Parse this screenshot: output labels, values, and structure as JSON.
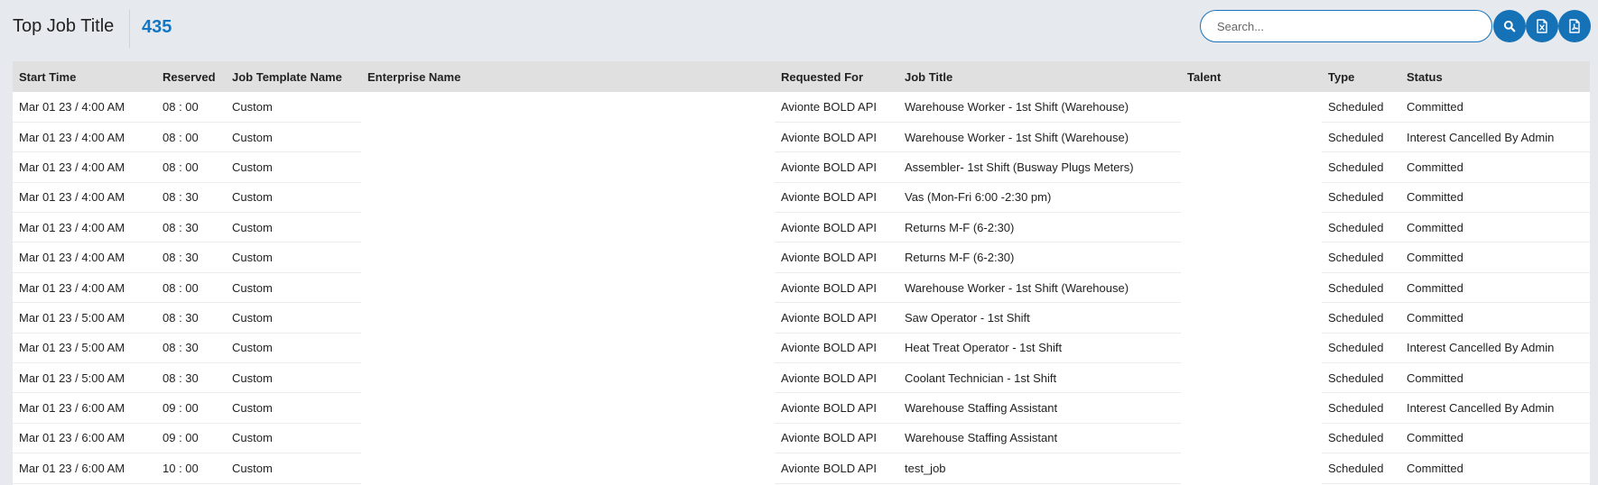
{
  "header": {
    "title": "Top Job Title",
    "count": "435"
  },
  "search": {
    "placeholder": "Search..."
  },
  "actions": {
    "search_icon": "search-icon",
    "excel_icon": "excel-export-icon",
    "pdf_icon": "pdf-export-icon"
  },
  "colors": {
    "accent": "#1572b6",
    "count": "#1177c4",
    "header_bg": "#e0e0e0",
    "page_bg": "#e6eaee"
  },
  "table": {
    "columns": [
      "Start Time",
      "Reserved",
      "Job Template Name",
      "Enterprise Name",
      "Requested For",
      "Job Title",
      "Talent",
      "Type",
      "Status"
    ],
    "rows": [
      [
        "Mar 01 23 / 4:00 AM",
        "08 : 00",
        "Custom",
        "",
        "Avionte BOLD API",
        "Warehouse Worker - 1st Shift (Warehouse)",
        "",
        "Scheduled",
        "Committed"
      ],
      [
        "Mar 01 23 / 4:00 AM",
        "08 : 00",
        "Custom",
        "",
        "Avionte BOLD API",
        "Warehouse Worker - 1st Shift (Warehouse)",
        "",
        "Scheduled",
        "Interest Cancelled By Admin"
      ],
      [
        "Mar 01 23 / 4:00 AM",
        "08 : 00",
        "Custom",
        "",
        "Avionte BOLD API",
        "Assembler- 1st Shift (Busway Plugs Meters)",
        "",
        "Scheduled",
        "Committed"
      ],
      [
        "Mar 01 23 / 4:00 AM",
        "08 : 30",
        "Custom",
        "",
        "Avionte BOLD API",
        "Vas (Mon-Fri 6:00 -2:30 pm)",
        "",
        "Scheduled",
        "Committed"
      ],
      [
        "Mar 01 23 / 4:00 AM",
        "08 : 30",
        "Custom",
        "",
        "Avionte BOLD API",
        "Returns M-F (6-2:30)",
        "",
        "Scheduled",
        "Committed"
      ],
      [
        "Mar 01 23 / 4:00 AM",
        "08 : 30",
        "Custom",
        "",
        "Avionte BOLD API",
        "Returns M-F (6-2:30)",
        "",
        "Scheduled",
        "Committed"
      ],
      [
        "Mar 01 23 / 4:00 AM",
        "08 : 00",
        "Custom",
        "",
        "Avionte BOLD API",
        "Warehouse Worker - 1st Shift (Warehouse)",
        "",
        "Scheduled",
        "Committed"
      ],
      [
        "Mar 01 23 / 5:00 AM",
        "08 : 30",
        "Custom",
        "",
        "Avionte BOLD API",
        "Saw Operator - 1st Shift",
        "",
        "Scheduled",
        "Committed"
      ],
      [
        "Mar 01 23 / 5:00 AM",
        "08 : 30",
        "Custom",
        "",
        "Avionte BOLD API",
        "Heat Treat Operator - 1st Shift",
        "",
        "Scheduled",
        "Interest Cancelled By Admin"
      ],
      [
        "Mar 01 23 / 5:00 AM",
        "08 : 30",
        "Custom",
        "",
        "Avionte BOLD API",
        "Coolant Technician - 1st Shift",
        "",
        "Scheduled",
        "Committed"
      ],
      [
        "Mar 01 23 / 6:00 AM",
        "09 : 00",
        "Custom",
        "",
        "Avionte BOLD API",
        "Warehouse Staffing Assistant",
        "",
        "Scheduled",
        "Interest Cancelled By Admin"
      ],
      [
        "Mar 01 23 / 6:00 AM",
        "09 : 00",
        "Custom",
        "",
        "Avionte BOLD API",
        "Warehouse Staffing Assistant",
        "",
        "Scheduled",
        "Committed"
      ],
      [
        "Mar 01 23 / 6:00 AM",
        "10 : 00",
        "Custom",
        "",
        "Avionte BOLD API",
        "test_job",
        "",
        "Scheduled",
        "Committed"
      ]
    ]
  }
}
